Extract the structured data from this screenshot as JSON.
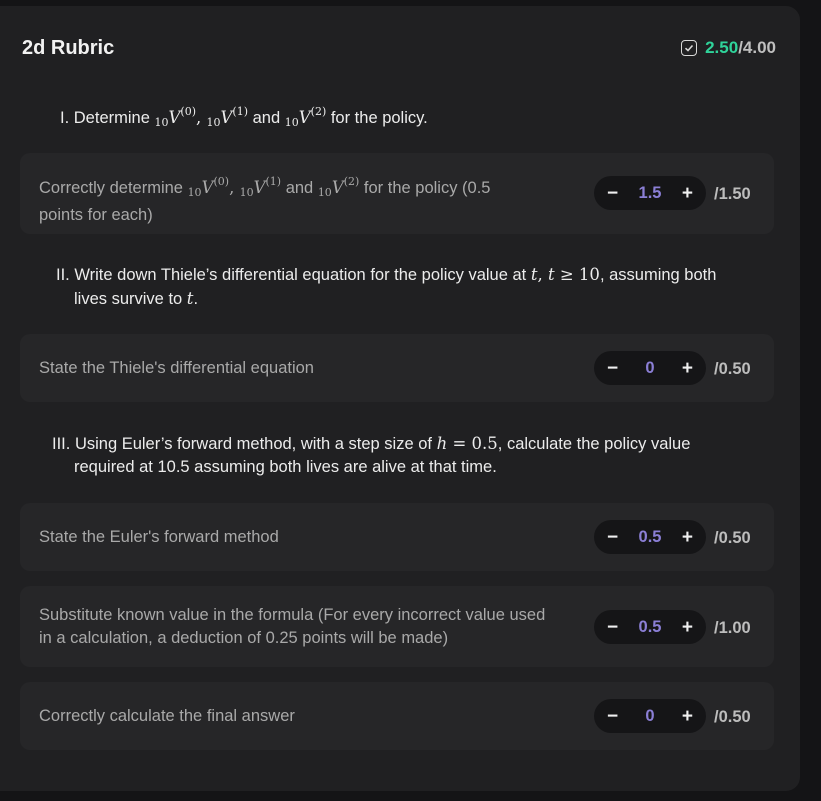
{
  "header": {
    "title": "2d Rubric",
    "score_obtained": "2.50",
    "score_total": "/4.00",
    "icon": "checkbox-check-icon"
  },
  "questions": [
    {
      "number": "I.",
      "text_pre": "Determine",
      "text_and": "and",
      "text_post": "for the policy."
    },
    {
      "number": "II.",
      "line1": "Write down Thiele’s differential equation for the policy value at",
      "line1_end": ", assuming both",
      "line2_pre": "lives survive to",
      "line2_post": "."
    },
    {
      "number": "III.",
      "line1_pre": "Using Euler’s forward method, with a step size of",
      "line1_post": ", calculate the policy value",
      "line2": "required at 10.5 assuming both lives are alive at that time."
    }
  ],
  "criteria": [
    {
      "text_pre": "Correctly determine",
      "text_and": "and",
      "text_post": "for the policy (0.5",
      "text_line2": "points for each)",
      "value": "1.5",
      "max": "/1.50"
    },
    {
      "text": "State the Thiele's differential equation",
      "value": "0",
      "max": "/0.50"
    },
    {
      "text": "State the Euler's forward method",
      "value": "0.5",
      "max": "/0.50"
    },
    {
      "text_line1": "Substitute known value in the formula (For every incorrect value used",
      "text_line2": "in a calculation, a deduction of 0.25 points will be made)",
      "value": "0.5",
      "max": "/1.00"
    },
    {
      "text": "Correctly calculate the final answer",
      "value": "0",
      "max": "/0.50"
    }
  ],
  "stepper": {
    "minus": "−",
    "plus": "+"
  }
}
